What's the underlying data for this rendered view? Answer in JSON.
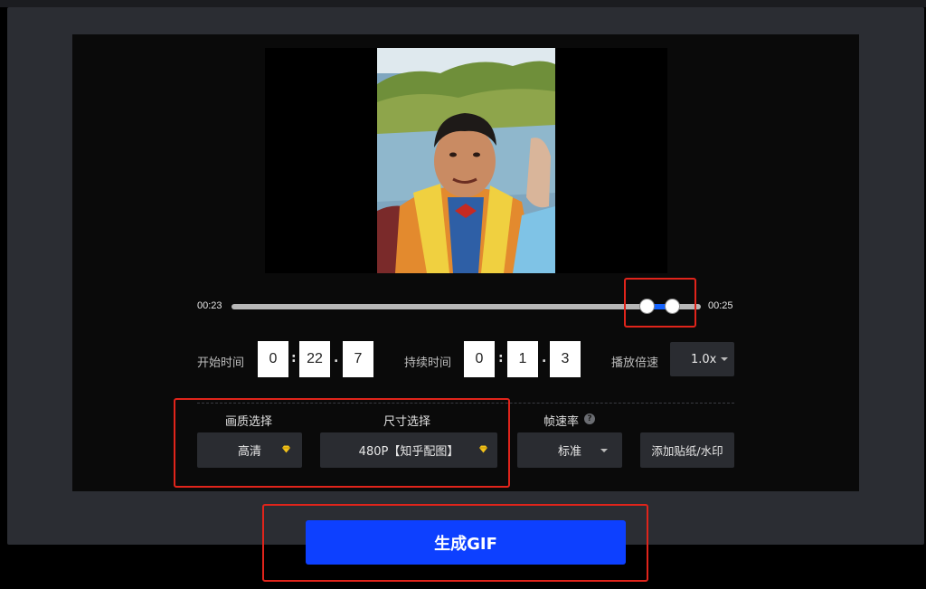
{
  "player": {
    "time_start": "00:23",
    "time_end": "00:25"
  },
  "trim": {
    "start_label": "开始时间",
    "start": [
      "0",
      "22",
      "7"
    ],
    "duration_label": "持续时间",
    "duration": [
      "0",
      "1",
      "3"
    ],
    "speed_label": "播放倍速",
    "speed_value": "1.0x",
    "sep_colon": ":",
    "sep_dot": "."
  },
  "options": {
    "quality_label": "画质选择",
    "quality_value": "高清",
    "size_label": "尺寸选择",
    "size_value": "480P【知乎配图】",
    "fps_label": "帧速率",
    "fps_value": "标准",
    "help_glyph": "?",
    "sticker_button": "添加贴纸/水印"
  },
  "generate_button": "生成GIF",
  "colors": {
    "accent": "#0d40ff",
    "highlight": "#e0241b",
    "range": "#1463ff",
    "gem": "#f2c21b"
  }
}
